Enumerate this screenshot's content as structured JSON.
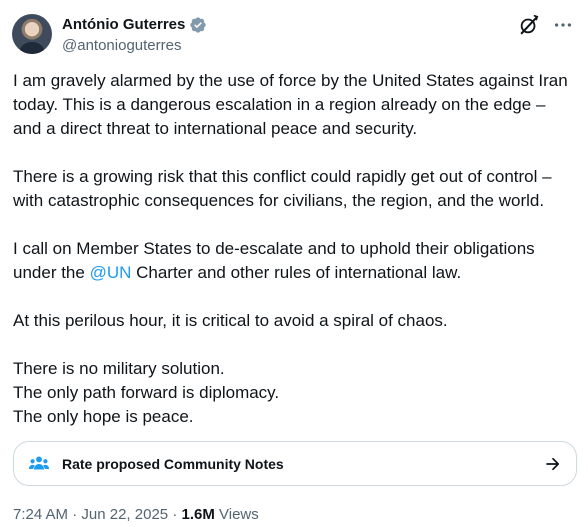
{
  "author": {
    "display_name": "António Guterres",
    "handle": "@antonioguterres",
    "verified": true,
    "avatar_icon": "profile-photo"
  },
  "icons": {
    "verified": "verified-badge-icon",
    "grok": "grok-icon",
    "more": "more-options-icon",
    "community_notes": "community-notes-people-icon",
    "arrow": "arrow-right-icon"
  },
  "colors": {
    "link": "#1d9bf0",
    "muted": "#536471",
    "text": "#0f1419",
    "border": "#cfd9de"
  },
  "tweet": {
    "p1": "I am gravely alarmed by the use of force by the United States against Iran today. This is a dangerous escalation in a region already on the edge – and a direct threat to international peace and security.",
    "p2": "There is a growing risk that this conflict could rapidly get out of control – with catastrophic consequences for civilians, the region, and the world.",
    "p3_before": "I call on Member States to de-escalate and to uphold their obligations under the ",
    "p3_mention": "@UN",
    "p3_after": " Charter and other rules of international law.",
    "p4": "At this perilous hour, it is critical to avoid a spiral of chaos.",
    "p5_lines": [
      "There is no military solution.",
      "The only path forward is diplomacy.",
      "The only hope is peace."
    ]
  },
  "community_notes": {
    "label": "Rate proposed Community Notes"
  },
  "meta": {
    "time": "7:24 AM",
    "date": "Jun 22, 2025",
    "separator": "·",
    "views_count": "1.6M",
    "views_label": "Views"
  }
}
